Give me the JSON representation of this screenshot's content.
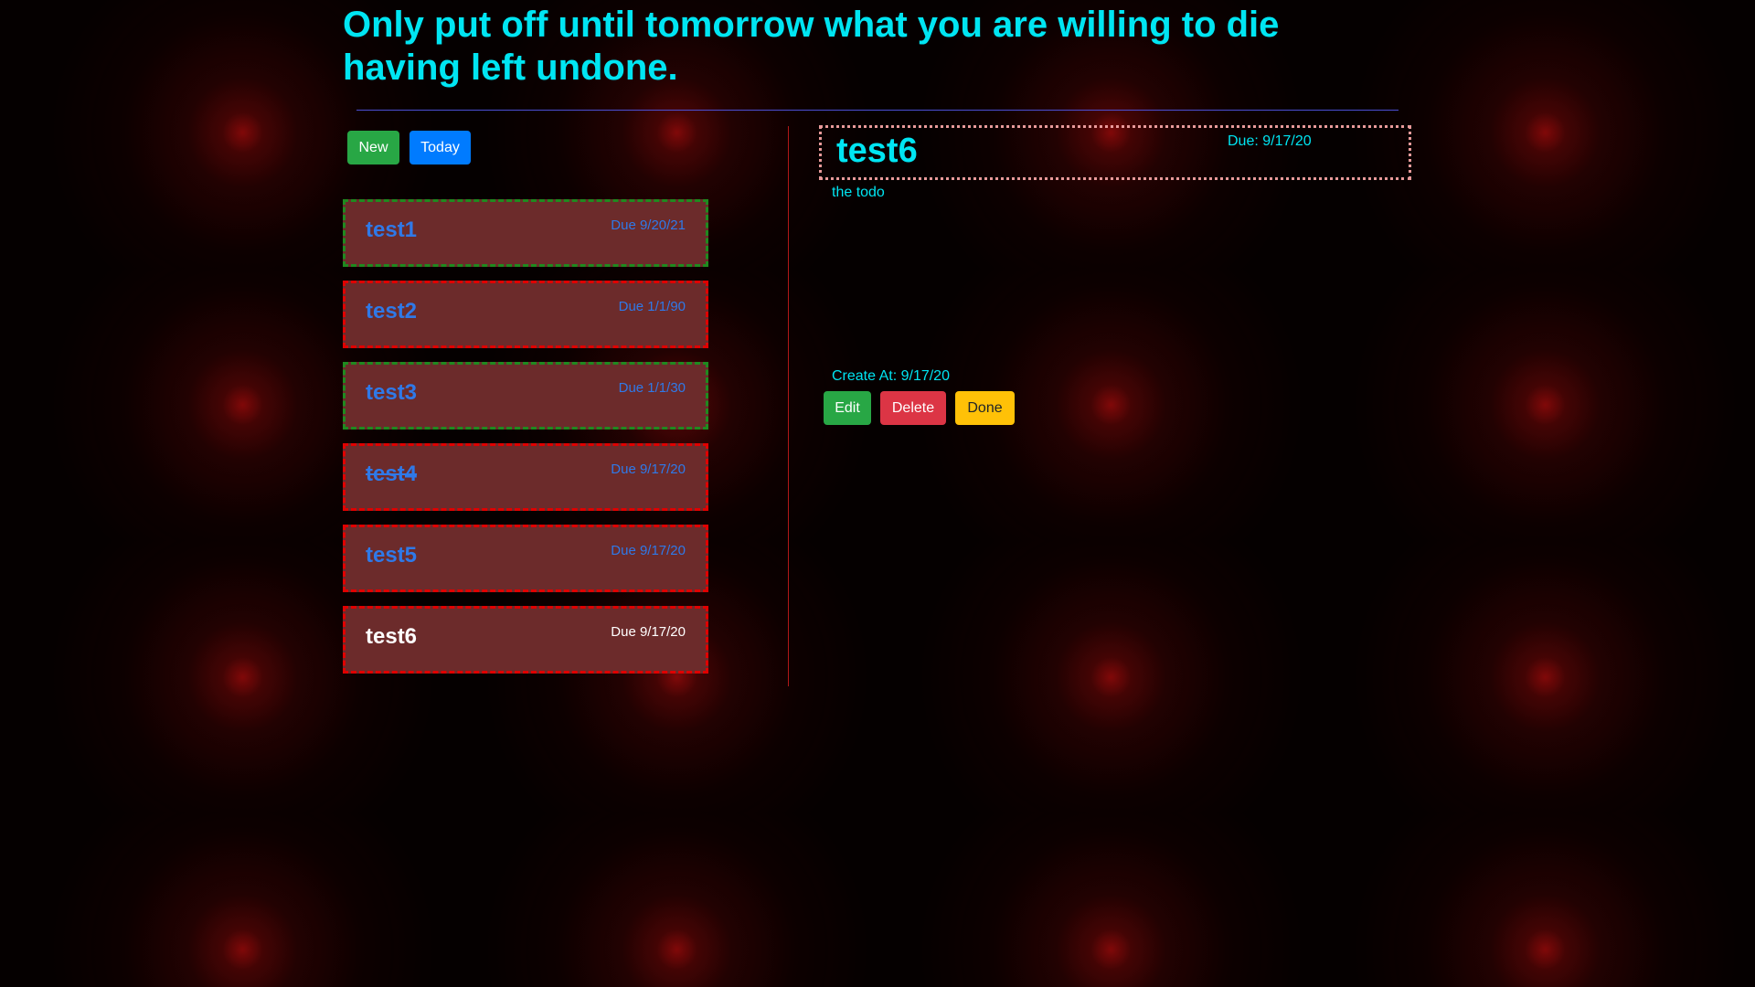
{
  "headline": "Only put off until tomorrow what you are willing to die having left undone.",
  "toolbar": {
    "new_label": "New",
    "today_label": "Today"
  },
  "todos": [
    {
      "title": "test1",
      "due": "Due 9/20/21",
      "border": "green",
      "struck": false,
      "active": false
    },
    {
      "title": "test2",
      "due": "Due 1/1/90",
      "border": "red",
      "struck": false,
      "active": false
    },
    {
      "title": "test3",
      "due": "Due 1/1/30",
      "border": "green",
      "struck": false,
      "active": false
    },
    {
      "title": "test4",
      "due": "Due 9/17/20",
      "border": "red",
      "struck": true,
      "active": false
    },
    {
      "title": "test5",
      "due": "Due 9/17/20",
      "border": "red",
      "struck": false,
      "active": false
    },
    {
      "title": "test6",
      "due": "Due 9/17/20",
      "border": "red",
      "struck": false,
      "active": true
    }
  ],
  "detail": {
    "title": "test6",
    "due": "Due: 9/17/20",
    "description": "the todo",
    "created": "Create At: 9/17/20",
    "edit_label": "Edit",
    "delete_label": "Delete",
    "done_label": "Done"
  },
  "colors": {
    "accent_cyan": "#00e5f2",
    "card_bg": "#6c2b2b",
    "border_red": "#e00000",
    "border_green": "#1f8a1f",
    "title_blue": "#2f79e8"
  }
}
